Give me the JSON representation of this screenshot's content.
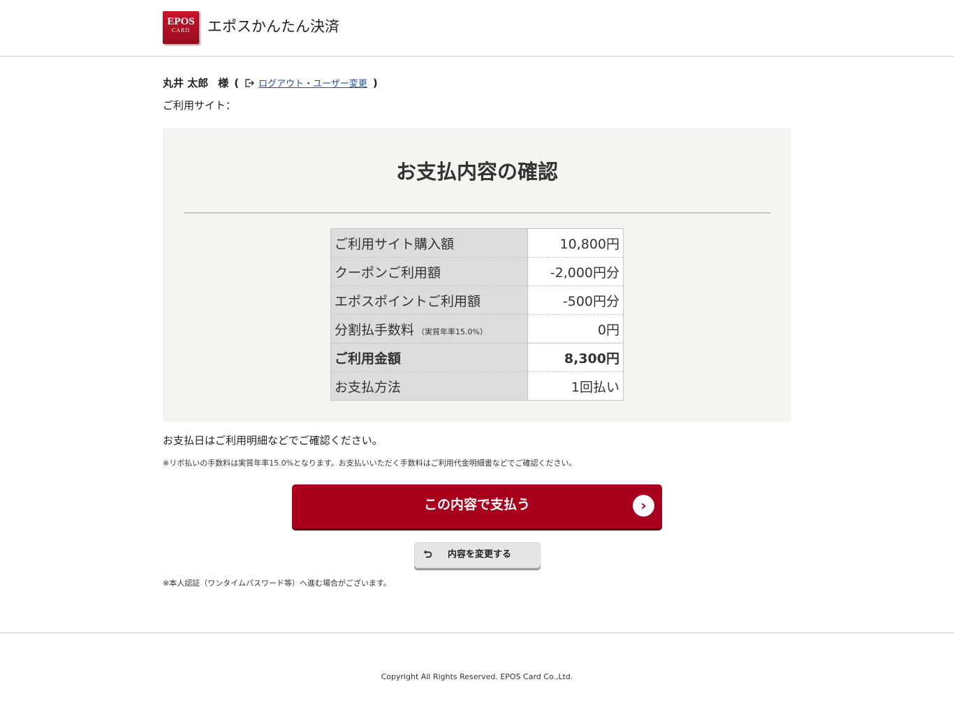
{
  "header": {
    "logo_line1": "EPOS",
    "logo_line2": "CARD",
    "title": "エポスかんたん決済"
  },
  "user": {
    "name": "丸井 太郎",
    "honorific": "様",
    "paren_open": "(",
    "logout_link": "ログアウト・ユーザー変更",
    "paren_close": ")",
    "site_label": "ご利用サイト："
  },
  "panel": {
    "title": "お支払内容の確認",
    "rows": [
      {
        "label": "ご利用サイト購入額",
        "value": "10,800円"
      },
      {
        "label": "クーポンご利用額",
        "value": "-2,000円分"
      },
      {
        "label": "エポスポイントご利用額",
        "value": "-500円分"
      },
      {
        "label": "分割払手数料",
        "label_note": "（実質年率15.0%）",
        "value": "0円"
      },
      {
        "label": "ご利用金額",
        "value": "8,300円"
      },
      {
        "label": "お支払方法",
        "value": "1回払い"
      }
    ]
  },
  "notes": {
    "payment_date": "お支払日はご利用明細などでご確認ください。",
    "revolving_fee": "※リボ払いの手数料は実質年率15.0%となります。お支払いいただく手数料はご利用代金明細書などでご確認ください。",
    "auth": "※本人認証（ワンタイムパスワード等）へ進む場合がございます。"
  },
  "buttons": {
    "pay": "この内容で支払う",
    "change": "内容を変更する"
  },
  "footer": {
    "copyright": "Copyright All Rights Reserved. EPOS Card Co.,Ltd."
  },
  "colors": {
    "brand": "#a8001c",
    "panel_bg": "#f6f4f0",
    "link": "#1f4e9c"
  },
  "icons": {
    "logout": "logout-icon",
    "pay_arrow": "chevron-right-icon",
    "back": "undo-arrow-icon"
  }
}
